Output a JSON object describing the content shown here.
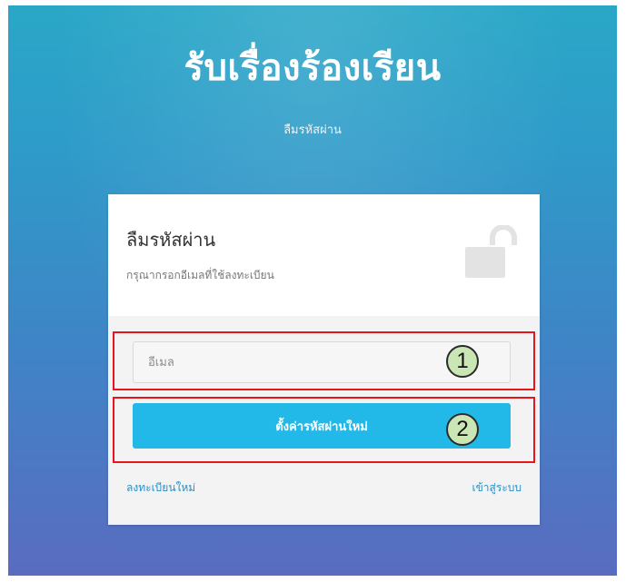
{
  "header": {
    "title": "รับเรื่องร้องเรียน",
    "subtitle": "ลืมรหัสผ่าน"
  },
  "card": {
    "title": "ลืมรหัสผ่าน",
    "description": "กรุณากรอกอีเมลที่ใช้ลงทะเบียน",
    "icon": "unlock-icon",
    "email_placeholder": "อีเมล",
    "email_value": "",
    "submit_label": "ตั้งค่ารหัสผ่านใหม่",
    "register_link": "ลงทะเบียนใหม่",
    "login_link": "เข้าสู่ระบบ"
  },
  "annotations": {
    "marker_1": "1",
    "marker_2": "2"
  },
  "colors": {
    "accent": "#22b8e8",
    "link": "#2a8fc4",
    "annotation_border": "#e8151e",
    "annotation_marker": "#c9e6b4"
  }
}
